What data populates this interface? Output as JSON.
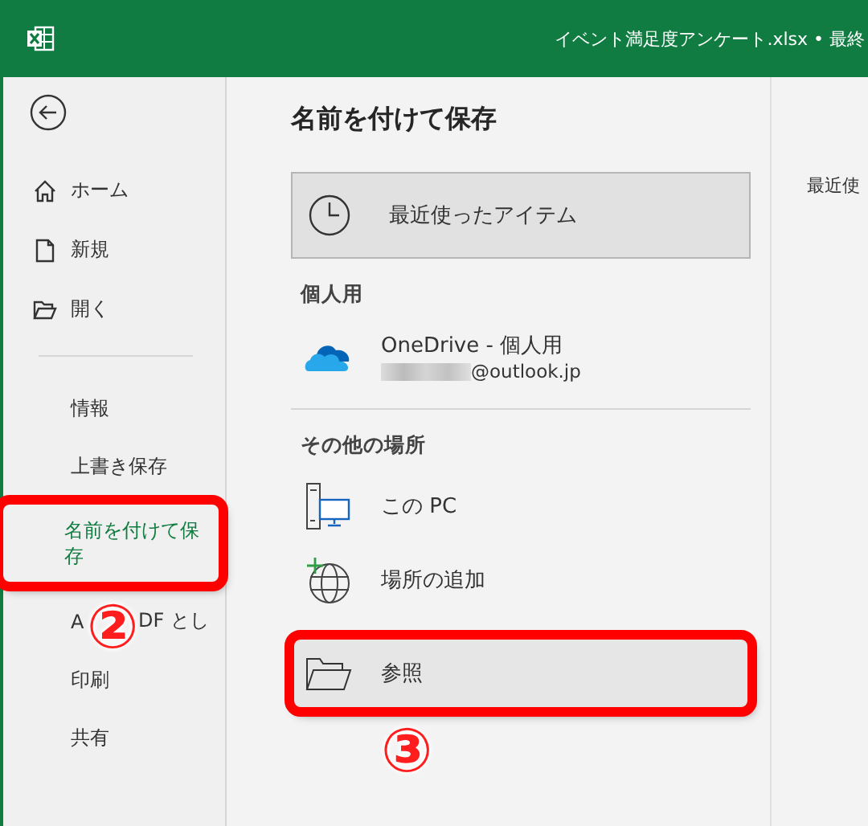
{
  "window": {
    "title": "イベント満足度アンケート.xlsx • 最終"
  },
  "sidebar": {
    "items": [
      {
        "kind": "icon",
        "label": "ホーム",
        "selected": false
      },
      {
        "kind": "icon",
        "label": "新規",
        "selected": false
      },
      {
        "kind": "icon",
        "label": "開く",
        "selected": false
      },
      {
        "kind": "divider"
      },
      {
        "kind": "text",
        "label": "情報",
        "selected": false
      },
      {
        "kind": "text",
        "label": "上書き保存",
        "selected": false
      },
      {
        "kind": "text",
        "label": "名前を付けて保存",
        "selected": true,
        "highlighted": true,
        "callout": "②"
      },
      {
        "kind": "partial",
        "parts": [
          "A",
          "DF とし"
        ],
        "selected": false
      },
      {
        "kind": "text",
        "label": "印刷",
        "selected": false
      },
      {
        "kind": "text",
        "label": "共有",
        "selected": false
      }
    ]
  },
  "page": {
    "title": "名前を付けて保存",
    "recent": {
      "label": "最近使ったアイテム",
      "selected": true
    },
    "sections": [
      {
        "heading": "個人用",
        "places": [
          {
            "kind": "onedrive",
            "label": "OneDrive - 個人用",
            "account": "@outlook.jp",
            "selected": false
          }
        ]
      },
      {
        "heading": "その他の場所",
        "places": [
          {
            "kind": "pc",
            "label": "この PC",
            "selected": false
          },
          {
            "kind": "add",
            "label": "場所の追加",
            "selected": false
          },
          {
            "kind": "browse",
            "label": "参照",
            "selected": true,
            "highlighted": true,
            "callout": "③"
          }
        ]
      }
    ]
  },
  "right_panel": {
    "label": "最近使"
  }
}
